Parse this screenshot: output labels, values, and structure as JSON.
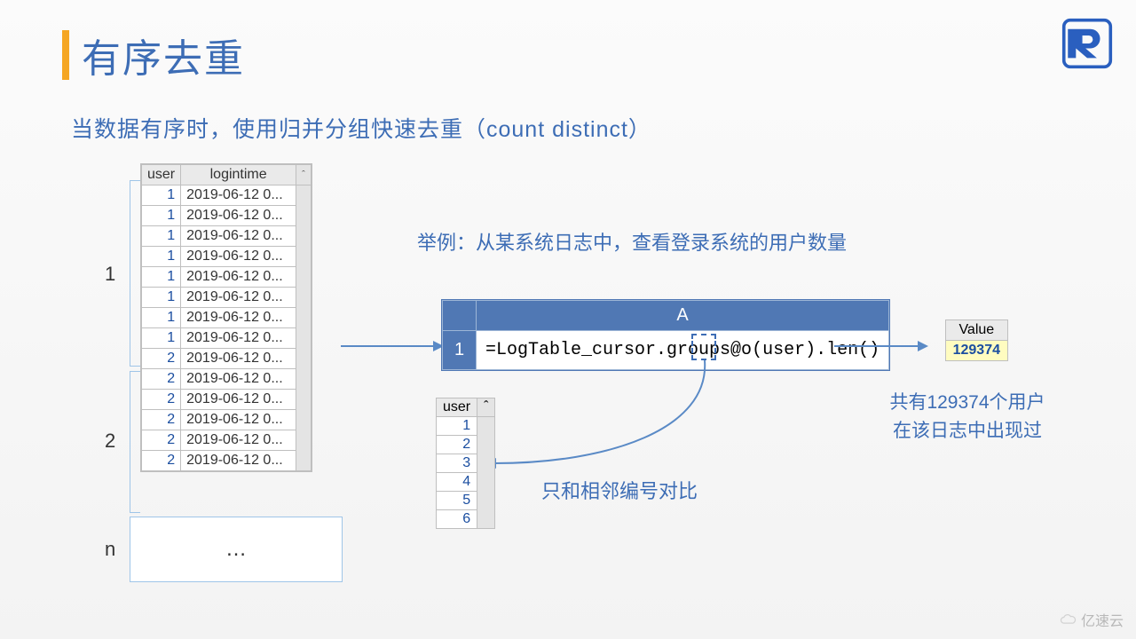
{
  "title": "有序去重",
  "subtitle": "当数据有序时，使用归并分组快速去重（count distinct）",
  "example_text": "举例：从某系统日志中，查看登录系统的用户数量",
  "log_table": {
    "headers": {
      "user": "user",
      "logintime": "logintime"
    },
    "scroll_indicator": "ˆ",
    "rows": [
      {
        "user": "1",
        "logintime": "2019-06-12 0..."
      },
      {
        "user": "1",
        "logintime": "2019-06-12 0..."
      },
      {
        "user": "1",
        "logintime": "2019-06-12 0..."
      },
      {
        "user": "1",
        "logintime": "2019-06-12 0..."
      },
      {
        "user": "1",
        "logintime": "2019-06-12 0..."
      },
      {
        "user": "1",
        "logintime": "2019-06-12 0..."
      },
      {
        "user": "1",
        "logintime": "2019-06-12 0..."
      },
      {
        "user": "1",
        "logintime": "2019-06-12 0..."
      },
      {
        "user": "2",
        "logintime": "2019-06-12 0..."
      },
      {
        "user": "2",
        "logintime": "2019-06-12 0..."
      },
      {
        "user": "2",
        "logintime": "2019-06-12 0..."
      },
      {
        "user": "2",
        "logintime": "2019-06-12 0..."
      },
      {
        "user": "2",
        "logintime": "2019-06-12 0..."
      },
      {
        "user": "2",
        "logintime": "2019-06-12 0..."
      }
    ]
  },
  "group_labels": {
    "g1": "1",
    "g2": "2",
    "gn": "n"
  },
  "ellipsis": "…",
  "code": {
    "col_header": "A",
    "row_header": "1",
    "formula_prefix": "=LogTable_cursor.groups@",
    "formula_highlight": "o",
    "formula_suffix": "(user).len()"
  },
  "user_list": {
    "header": "user",
    "scroll_indicator": "ˆ",
    "values": [
      "1",
      "2",
      "3",
      "4",
      "5",
      "6"
    ]
  },
  "adjacent_text": "只和相邻编号对比",
  "result": {
    "header": "Value",
    "value": "129374",
    "caption_line1": "共有129374个用户",
    "caption_line2": "在该日志中出现过"
  },
  "watermark": "亿速云"
}
